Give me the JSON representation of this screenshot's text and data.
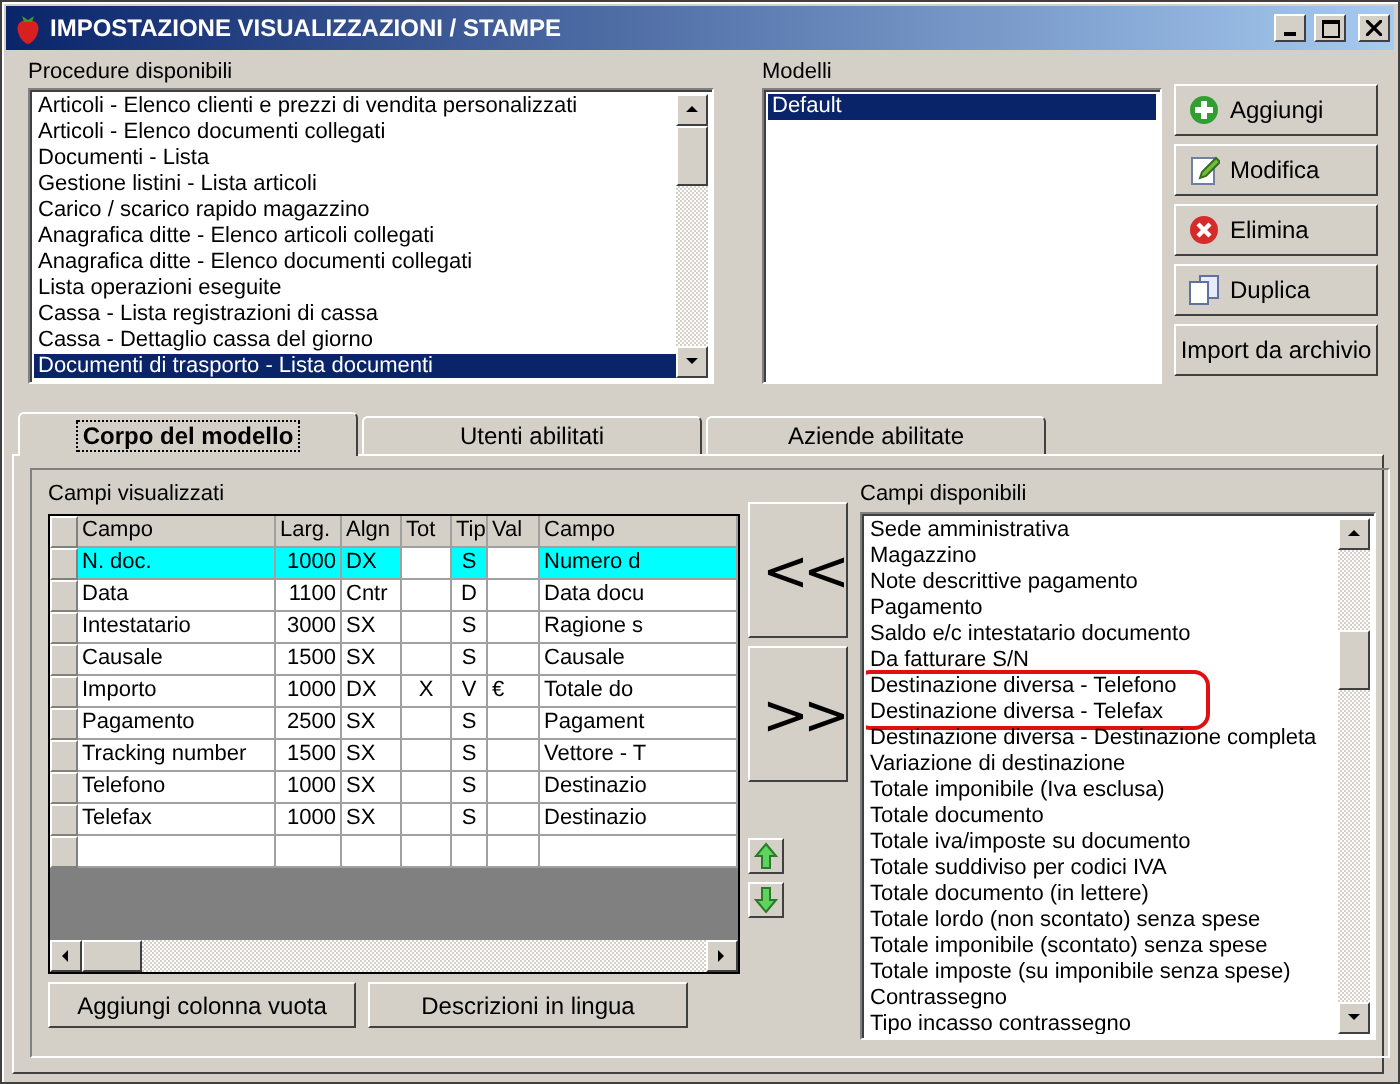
{
  "window": {
    "title": "IMPOSTAZIONE VISUALIZZAZIONI / STAMPE"
  },
  "procedures": {
    "label": "Procedure disponibili",
    "items": [
      {
        "text": "Articoli - Elenco clienti e prezzi di vendita personalizzati",
        "selected": false
      },
      {
        "text": "Articoli - Elenco documenti collegati",
        "selected": false
      },
      {
        "text": "Documenti - Lista",
        "selected": false
      },
      {
        "text": "Gestione listini - Lista articoli",
        "selected": false
      },
      {
        "text": "Carico / scarico rapido magazzino",
        "selected": false
      },
      {
        "text": "Anagrafica ditte - Elenco articoli collegati",
        "selected": false
      },
      {
        "text": "Anagrafica ditte - Elenco documenti collegati",
        "selected": false
      },
      {
        "text": "Lista operazioni eseguite",
        "selected": false
      },
      {
        "text": "Cassa - Lista registrazioni di cassa",
        "selected": false
      },
      {
        "text": "Cassa - Dettaglio cassa del giorno",
        "selected": false
      },
      {
        "text": "Documenti di trasporto - Lista documenti",
        "selected": true
      }
    ]
  },
  "models": {
    "label": "Modelli",
    "items": [
      {
        "text": "Default",
        "selected": true
      }
    ]
  },
  "model_buttons": [
    {
      "label": "Aggiungi",
      "kind": "add"
    },
    {
      "label": "Modifica",
      "kind": "edit"
    },
    {
      "label": "Elimina",
      "kind": "delete"
    },
    {
      "label": "Duplica",
      "kind": "copy"
    },
    {
      "label": "Import da archivio",
      "kind": "plain"
    }
  ],
  "tabs": [
    {
      "label": "Corpo del modello",
      "selected": true
    },
    {
      "label": "Utenti abilitati",
      "selected": false
    },
    {
      "label": "Aziende abilitate",
      "selected": false
    }
  ],
  "visible_fields": {
    "label": "Campi visualizzati",
    "columns": [
      "Campo",
      "Larg.",
      "Algn",
      "Tot",
      "Tip",
      "Val",
      "Campo"
    ],
    "rows": [
      {
        "cells": [
          "N. doc.",
          "1000",
          "DX",
          "",
          "S",
          "",
          "Numero d"
        ],
        "selected": true
      },
      {
        "cells": [
          "Data",
          "1100",
          "Cntr",
          "",
          "D",
          "",
          "Data docu"
        ],
        "selected": false
      },
      {
        "cells": [
          "Intestatario",
          "3000",
          "SX",
          "",
          "S",
          "",
          "Ragione s"
        ],
        "selected": false
      },
      {
        "cells": [
          "Causale",
          "1500",
          "SX",
          "",
          "S",
          "",
          "Causale"
        ],
        "selected": false
      },
      {
        "cells": [
          "Importo",
          "1000",
          "DX",
          "X",
          "V",
          "€",
          "Totale do"
        ],
        "selected": false
      },
      {
        "cells": [
          "Pagamento",
          "2500",
          "SX",
          "",
          "S",
          "",
          "Pagament"
        ],
        "selected": false
      },
      {
        "cells": [
          "Tracking number",
          "1500",
          "SX",
          "",
          "S",
          "",
          "Vettore - T"
        ],
        "selected": false
      },
      {
        "cells": [
          "Telefono",
          "1000",
          "SX",
          "",
          "S",
          "",
          "Destinazio"
        ],
        "selected": false
      },
      {
        "cells": [
          "Telefax",
          "1000",
          "SX",
          "",
          "S",
          "",
          "Destinazio"
        ],
        "selected": false
      }
    ]
  },
  "grid_buttons": [
    "Aggiungi colonna vuota",
    "Descrizioni in lingua"
  ],
  "move_buttons": [
    "<<",
    ">>"
  ],
  "order_buttons": [
    {
      "kind": "up"
    },
    {
      "kind": "down"
    }
  ],
  "available_fields": {
    "label": "Campi disponibili",
    "items": [
      {
        "text": "Sede amministrativa",
        "marked": false
      },
      {
        "text": "Magazzino",
        "marked": false
      },
      {
        "text": "Note descrittive pagamento",
        "marked": false
      },
      {
        "text": "Pagamento",
        "marked": false
      },
      {
        "text": "Saldo e/c intestatario documento",
        "marked": false
      },
      {
        "text": "Da fatturare S/N",
        "marked": false
      },
      {
        "text": "Destinazione diversa - Telefono",
        "marked": true
      },
      {
        "text": "Destinazione diversa - Telefax",
        "marked": true
      },
      {
        "text": "Destinazione diversa - Destinazione completa",
        "marked": false
      },
      {
        "text": "Variazione di destinazione",
        "marked": false
      },
      {
        "text": "Totale imponibile (Iva esclusa)",
        "marked": false
      },
      {
        "text": "Totale documento",
        "marked": false
      },
      {
        "text": "Totale iva/imposte su documento",
        "marked": false
      },
      {
        "text": "Totale suddiviso per codici IVA",
        "marked": false
      },
      {
        "text": "Totale documento (in lettere)",
        "marked": false
      },
      {
        "text": "Totale lordo (non scontato) senza spese",
        "marked": false
      },
      {
        "text": "Totale imponibile (scontato) senza spese",
        "marked": false
      },
      {
        "text": "Totale imposte (su imponibile senza spese)",
        "marked": false
      },
      {
        "text": "Contrassegno",
        "marked": false
      },
      {
        "text": "Tipo incasso contrassegno",
        "marked": false
      }
    ]
  }
}
